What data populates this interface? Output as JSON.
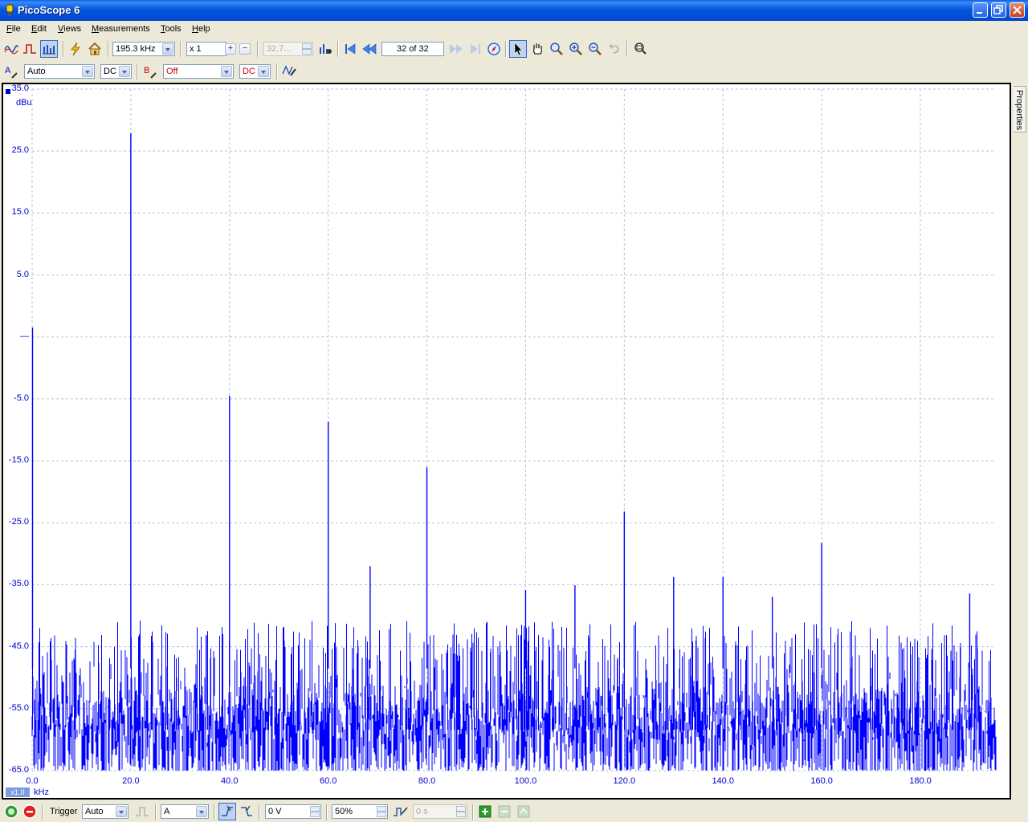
{
  "window": {
    "title": "PicoScope 6"
  },
  "menu": [
    {
      "label": "File",
      "key": "F",
      "rest": "ile"
    },
    {
      "label": "Edit",
      "key": "E",
      "rest": "dit"
    },
    {
      "label": "Views",
      "key": "V",
      "rest": "iews"
    },
    {
      "label": "Measurements",
      "key": "M",
      "rest": "easurements"
    },
    {
      "label": "Tools",
      "key": "T",
      "rest": "ools"
    },
    {
      "label": "Help",
      "key": "H",
      "rest": "elp"
    }
  ],
  "toolbar": {
    "frequency": "195.3 kHz",
    "zoom": "x 1",
    "disabled_value": "32.7...",
    "buffer_position": "32 of 32"
  },
  "channels": {
    "a_label": "A",
    "a_range": "Auto",
    "a_coupling": "DC",
    "b_label": "B",
    "b_range": "Off",
    "b_coupling": "DC"
  },
  "scope": {
    "y_unit": "dBu",
    "x_unit": "kHz",
    "x_scale": "x1.0",
    "properties_tab": "Properties"
  },
  "bottom": {
    "trigger_label": "Trigger",
    "trigger_mode": "Auto",
    "trigger_source": "A",
    "trigger_level": "0 V",
    "pretrigger": "50%",
    "delay": "0 s"
  },
  "colors": {
    "trace": "#0000ff",
    "axis_text": "#0000cc",
    "grid": "#a8c8d8"
  },
  "chart_data": {
    "type": "line",
    "title": "",
    "xlabel": "kHz",
    "ylabel": "dBu",
    "xlim": [
      0,
      195.3
    ],
    "ylim": [
      -65,
      35
    ],
    "x_ticks": [
      "0.0",
      "20.0",
      "40.0",
      "60.0",
      "80.0",
      "100.0",
      "120.0",
      "140.0",
      "160.0",
      "180.0"
    ],
    "y_ticks": [
      "35.0",
      "25.0",
      "15.0",
      "5.0",
      "",
      "-5.0",
      "-15.0",
      "-25.0",
      "-35.0",
      "-45.0",
      "-55.0",
      "-65.0"
    ],
    "noise_floor": [
      -65,
      -49
    ],
    "peaks": [
      {
        "x": 0.0,
        "y": 0.0
      },
      {
        "x": 20.0,
        "y": 28.5
      },
      {
        "x": 40.0,
        "y": -10.0
      },
      {
        "x": 60.0,
        "y": -13.8
      },
      {
        "x": 68.5,
        "y": -35.0
      },
      {
        "x": 80.0,
        "y": -20.5
      },
      {
        "x": 100.0,
        "y": -38.5
      },
      {
        "x": 110.0,
        "y": -37.8
      },
      {
        "x": 120.0,
        "y": -27.0
      },
      {
        "x": 130.0,
        "y": -36.6
      },
      {
        "x": 140.0,
        "y": -36.6
      },
      {
        "x": 150.0,
        "y": -39.5
      },
      {
        "x": 160.0,
        "y": -31.6
      },
      {
        "x": 190.0,
        "y": -39.0
      }
    ]
  }
}
